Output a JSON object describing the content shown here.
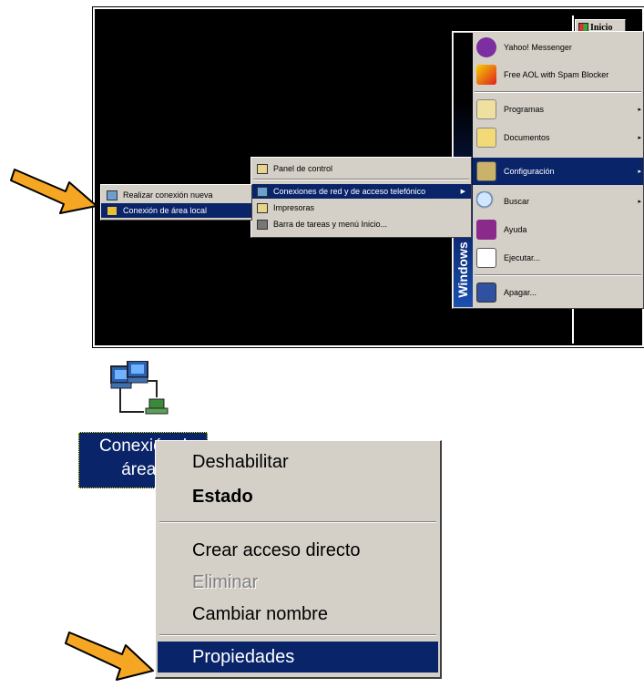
{
  "start_menu": {
    "start_button": "Inicio",
    "banner": "Windows Professional",
    "banner_visible": "Windows sional",
    "items": [
      {
        "label": "Yahoo! Messenger",
        "icon": "yahoo-messenger-icon"
      },
      {
        "label": "Free AOL with Spam Blocker",
        "icon": "aol-icon"
      },
      {
        "label": "Programas",
        "icon": "programs-folder-icon"
      },
      {
        "label": "Documentos",
        "icon": "documents-folder-icon"
      },
      {
        "label": "Configuración",
        "icon": "settings-icon"
      },
      {
        "label": "Buscar",
        "icon": "search-icon"
      },
      {
        "label": "Ayuda",
        "icon": "help-book-icon"
      },
      {
        "label": "Ejecutar...",
        "icon": "run-icon"
      },
      {
        "label": "Apagar...",
        "icon": "shutdown-icon"
      }
    ]
  },
  "config_menu": {
    "items": [
      {
        "label": "Panel de control"
      },
      {
        "label": "Conexiones de red y de acceso telefónico"
      },
      {
        "label": "Impresoras"
      },
      {
        "label": "Barra de tareas y menú Inicio..."
      }
    ]
  },
  "net_menu": {
    "items": [
      {
        "label": "Realizar conexión nueva"
      },
      {
        "label": "Conexión de área local"
      }
    ]
  },
  "desktop_icon": {
    "line1": "Conexión d",
    "line2": "área l"
  },
  "context_menu": {
    "items": [
      {
        "label": "Deshabilitar"
      },
      {
        "label": "Estado"
      },
      {
        "label": "Crear acceso directo"
      },
      {
        "label": "Eliminar"
      },
      {
        "label": "Cambiar nombre"
      },
      {
        "label": "Propiedades"
      }
    ]
  },
  "colors": {
    "highlight": "#0a246a",
    "menu_bg": "#d4d0c8",
    "arrow": "#f5a623"
  }
}
